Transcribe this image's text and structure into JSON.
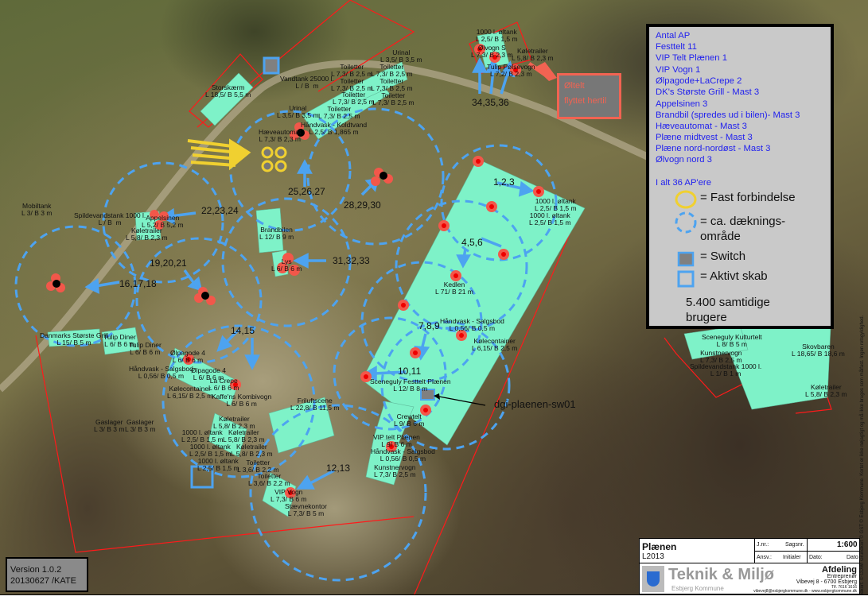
{
  "colors": {
    "coverage": "#4da3f0",
    "ap": "#f2574a",
    "fixed": "#f0d030",
    "area": "#7ef2c8",
    "boundary": "#ff1a1a",
    "legend_text": "#2222ee"
  },
  "legend": {
    "title": "Antal AP",
    "items": [
      "Festtelt 11",
      "VIP Telt Plænen 1",
      "VIP Vogn 1",
      "Ølpagode+LaCrepe 2",
      "DK's Største Grill - Mast 3",
      "Appelsinen 3",
      "Brandbil (spredes ud i bilen)- Mast 3",
      "Hæveautomat - Mast 3",
      "Plæne midtvest - Mast 3",
      "Plæne nord-nordøst - Mast 3",
      "Ølvogn nord 3"
    ],
    "total": "I alt 36 AP'ere",
    "symbols": {
      "fixed": "= Fast forbindelse",
      "coverage_1": "= ca. dæknings-",
      "coverage_2": "område",
      "switch": "= Switch",
      "cabinet": "= Aktivt skab"
    },
    "users_1": "5.400 samtidige",
    "users_2": "brugere"
  },
  "moved_note": {
    "line1": "Øltelt",
    "line2": "flyttet hertil"
  },
  "switch_label": "dgi-plaenen-sw01",
  "ap_groups": [
    "34,35,36",
    "1,2,3",
    "4,5,6",
    "25,26,27",
    "28,29,30",
    "22,23,24",
    "19,20,21",
    "16,17,18",
    "31,32,33",
    "14,15",
    "7,8,9",
    "10,11",
    "12,13"
  ],
  "map": {
    "labels": [
      "Storskærm\nL 18,5/ B 5,5 m",
      "Vandtank 25000 l.\nL / B  m",
      "Urinal\nL 3,5/ B 3,5 m",
      "Toiletter\nL 7,3/ B 2,5 m",
      "Toiletter\nL 7,3/ B 2,5 m",
      "Toiletter\nL 7,3/ B 2,5 m",
      "Toiletter\nL 7,3/ B 2,5 m",
      "Toiletter\nL 7,3/ B 2,5 m",
      "Toiletter\nL 7,3/ B 2,5 m",
      "Toiletter\nL 7,3/ B 2,5 m",
      "Urinal\nL 3,5/ B 3,5 m",
      "Hæveautomat\nL 7,3/ B 2,3 m",
      "Håndvask - Koldtvand\nL 2,5/ B 1,865 m",
      "1000 l. øltank\nL 2,5/ B 1,5 m",
      "Ølvogn S\nL 7,3/ B 2,3 m",
      "Køletrailer\nL 5,8/ B 2,3 m",
      "Tulip Pølsevogn\nL 7,2/ B 2,3 m",
      "1000 l. øltank\nL 2,5/ B 1,5 m",
      "1000 l. øltank\nL 2,5/ B 1,5 m",
      "Brandbilen\nL 12/ B 9 m",
      "Lys\nL 6/ B 6 m",
      "Kedlen\nL 71/ B 21 m",
      "Mobiltank\nL 3/ B 3 m",
      "Spildevandstank 1000 l.\nL / B  m",
      "Appelsinen\nL 5,2/ B 5,2 m",
      "Køletrailer\nL 5,8/ B 2,3 m",
      "Danmarks Største Grill\nL 15/ B 5 m",
      "Tulip Diner\nL 6/ B 6 m",
      "Tulip Diner\nL 6/ B 6 m",
      "Ølpagode 4\nL 6/ B 6 m",
      "Håndvask - Salgsbod\nL 0,56/ B 0,5 m",
      "Ølpagode 4\nL 6/ B 6 m",
      "La Crepe\nL 6/ B 6 m",
      "Kølecontainer\nL 6,15/ B 2,5 m",
      "Kaffe'ns Kombivogn\nL 6/ B 6 m",
      "Friluftscene\nL 22,8/ B 11,5 m",
      "Gaslager\nL 3/ B 3 m",
      "Gaslager\nL 3/ B 3 m",
      "Køletrailer\nL 5,8/ B 2,3 m",
      "1000 l. øltank\nL 2,5/ B 1,5 m",
      "Køletrailer\nL 5,8/ B 2,3 m",
      "1000 l. øltank\nL 2,5/ B 1,5 m",
      "Køletrailer\nL 5,8/ B 2,3 m",
      "1000 l. øltank\nL 2,5/ B 1,5 m",
      "Toiletter\nL 3,6/ B 2,2 m",
      "Toiletter\nL 3,6/ B 2,2 m",
      "VIP Vogn\nL 7,3/ B 6 m",
      "Stævnekontor\nL 7,3/ B 5 m",
      "Håndvask - Salgsbod\nL 0,56/ B 0,5 m",
      "Kølecontainer\nL 6,15/ B 2,5 m",
      "Sceneguly Festtelt Plænen\nL 12/ B 8 m",
      "Crewtelt\nL 9/ B 6 m",
      "VIP telt Plænen\nL 9/ B 6 m",
      "Håndvask - Salgsbod\nL 0,56/ B 0,5 m",
      "Kunstnervogn\nL 7,3/ B 2,5 m",
      "Sceneguly Kulturtelt\nL 8/ B 5 m",
      "Kunstnervogn\nL 7,3/ B 2,5 m",
      "Spildevandstank 1000 l.\nL 1/ B 1 m",
      "Skovbaren\nL 18,65/ B 18,6 m",
      "Køletrailer\nL 5,8/ B 2,3 m"
    ]
  },
  "version": {
    "line1": "Version 1.0.2",
    "line2": "20130627 /KATE"
  },
  "title_block": {
    "name": "Plænen",
    "code": "L2013",
    "jnr": "J.nr.:",
    "sagsnr": "Sagsnr.",
    "scale": "1:600",
    "ansv": "Ansv.:",
    "initialer": "Initialer",
    "dato_label": "Dato:",
    "dato": "Dato",
    "org": "Teknik & Miljø",
    "municipality": "Esbjerg Kommune",
    "department": "Afdeling",
    "unit": "Entreprenør",
    "address": "Vibevej 8 - 6700 Esbjerg",
    "phone": "Tlf. 7616 1616",
    "contact": "vibevej8@esbjergkommune.dk - www.esbjergkommune.dk"
  },
  "copyright": "Grundkort: © COWI Grundkort © GST © Esbjerg Kommune. Kortet er ikke nøjagtigt og må ikke bruges som målfast. Ingen retsgyldighed."
}
